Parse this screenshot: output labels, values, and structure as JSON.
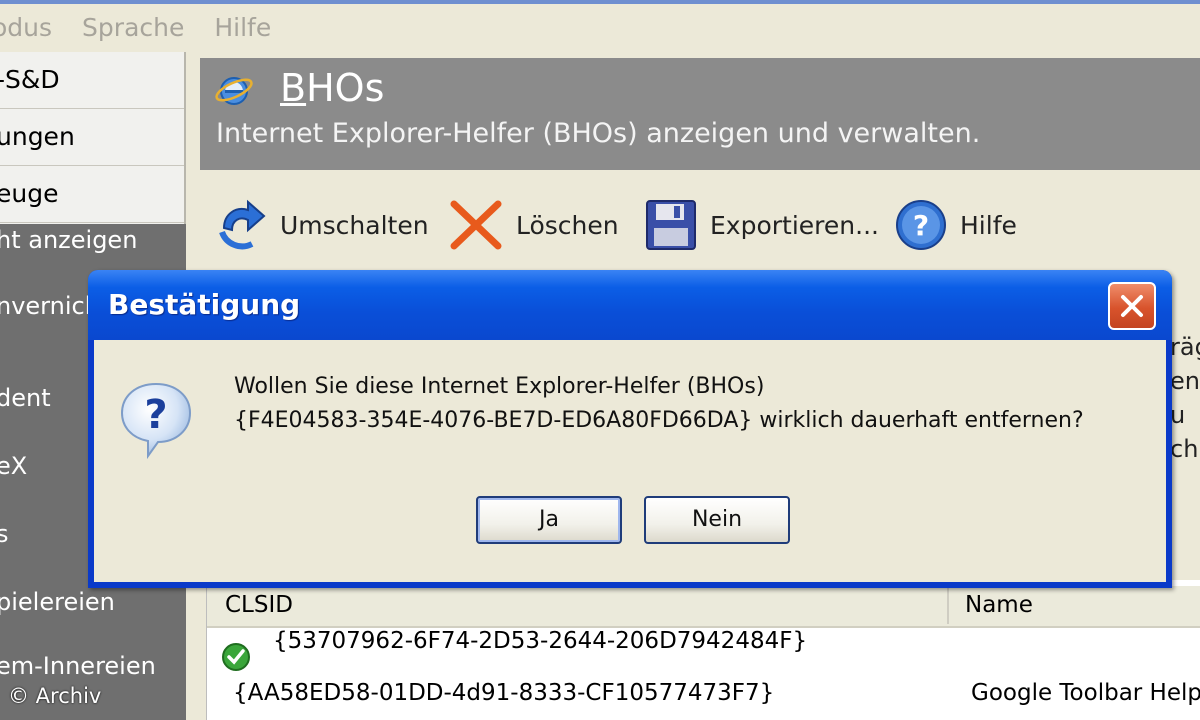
{
  "menu": [
    "odus",
    "Sprache",
    "Hilfe"
  ],
  "sidebar": {
    "light_items": [
      "-S&D",
      "ungen",
      "euge"
    ],
    "dark_items": [
      "ht anzeigen",
      "nvernich",
      "dent",
      "eX",
      "s",
      "pielereien",
      "em-Innereien"
    ]
  },
  "header": {
    "title_first": "B",
    "title_rest": "HOs",
    "subtitle": "Internet Explorer-Helfer (BHOs) anzeigen und verwalten."
  },
  "toolbar": {
    "toggle": "Umschalten",
    "delete": "Löschen",
    "export": "Exportieren...",
    "help": "Hilfe"
  },
  "list": {
    "columns": [
      "CLSID",
      "Name"
    ],
    "rows": [
      {
        "clsid": "{53707962-6F74-2D53-2644-206D7942484F}",
        "name": ""
      },
      {
        "clsid": "{AA58ED58-01DD-4d91-8333-CF10577473F7}",
        "name": "Google Toolbar Help"
      }
    ]
  },
  "right_fragments": [
    "räg",
    "en",
    "u",
    "ch"
  ],
  "dialog": {
    "title": "Bestätigung",
    "line1": "Wollen Sie diese Internet Explorer-Helfer (BHOs)",
    "line2": "{F4E04583-354E-4076-BE7D-ED6A80FD66DA} wirklich dauerhaft entfernen?",
    "yes": "Ja",
    "no": "Nein"
  },
  "watermark": "© Archiv",
  "colors": {
    "title_bar": "#0a4fd8",
    "header_band": "#8b8b8b",
    "sidebar_dark": "#6f6f6f",
    "dialog_body": "#ece9d8"
  }
}
